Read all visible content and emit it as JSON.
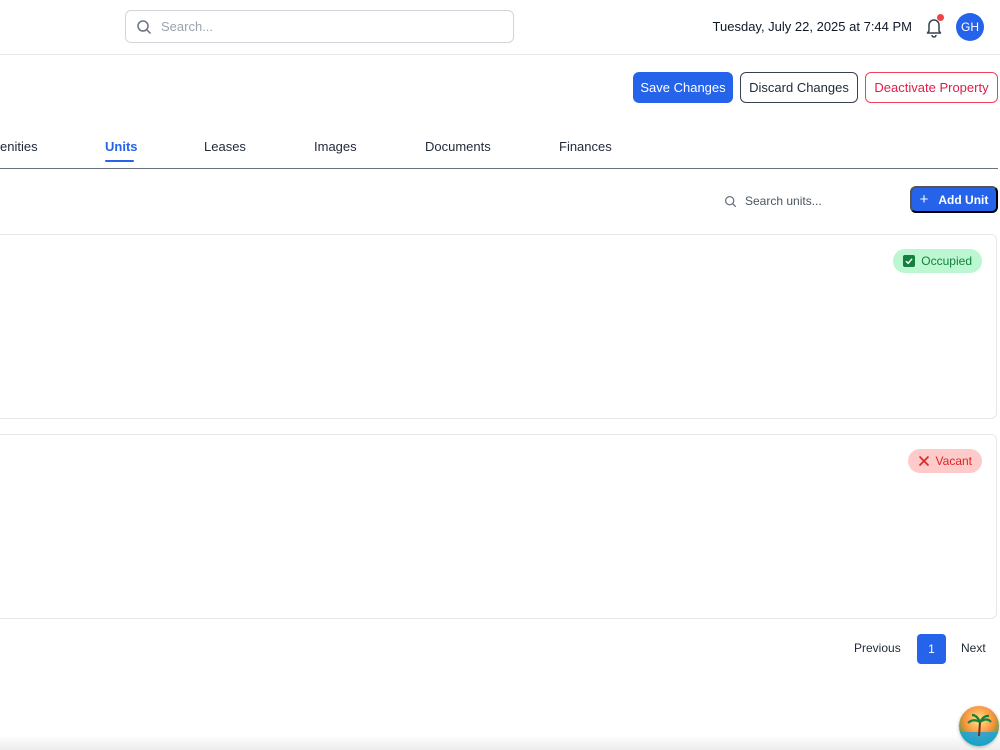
{
  "header": {
    "search_placeholder": "Search...",
    "datetime": "Tuesday, July 22, 2025 at 7:44 PM",
    "avatar_initials": "GH"
  },
  "actions": {
    "save": "Save Changes",
    "discard": "Discard Changes",
    "deactivate": "Deactivate Property"
  },
  "tabs": [
    {
      "label": "enities"
    },
    {
      "label": "Units",
      "active": true
    },
    {
      "label": "Leases"
    },
    {
      "label": "Images"
    },
    {
      "label": "Documents"
    },
    {
      "label": "Finances"
    }
  ],
  "units_toolbar": {
    "search_placeholder": "Search units...",
    "add_label": "Add Unit"
  },
  "units": [
    {
      "status": "Occupied"
    },
    {
      "status": "Vacant"
    }
  ],
  "pagination": {
    "previous": "Previous",
    "current_page": "1",
    "next": "Next"
  },
  "colors": {
    "accent": "#2563eb",
    "danger": "#e11d48",
    "occupied_bg": "#bbf7d0",
    "occupied_fg": "#15803d",
    "vacant_bg": "#fecaca",
    "vacant_fg": "#dc2626"
  },
  "icons": {
    "search": "search-icon",
    "bell": "bell-icon",
    "plus": "plus-icon",
    "check": "check-square-icon",
    "close": "x-icon"
  }
}
